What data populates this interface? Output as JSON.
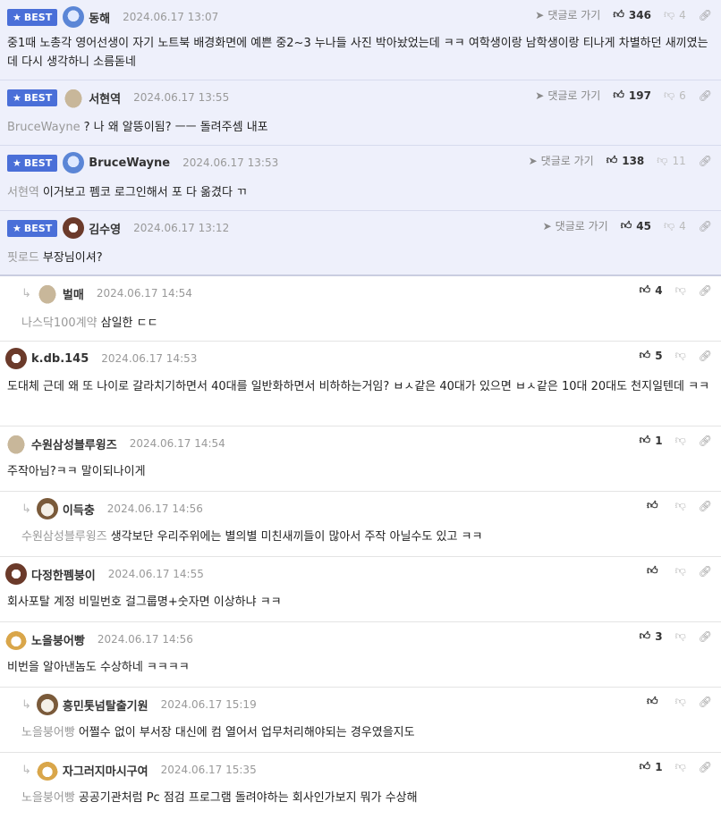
{
  "comments": [
    {
      "best": true,
      "badge": "BEST",
      "avatar": "av-blue",
      "nick": "동해",
      "date": "2024.06.17 13:07",
      "reply_label": "댓글로 가기",
      "up": "346",
      "down": "4",
      "text": "중1때 노총각 영어선생이 자기 노트북 배경화면에 예쁜 중2~3 누나들 사진 박아놨었는데 ㅋㅋ 여학생이랑 남학생이랑 티나게 차별하던 새끼였는데 다시 생각하니 소름돋네",
      "mention": ""
    },
    {
      "best": true,
      "badge": "BEST",
      "avatar": "av-tan",
      "nick": "서현역",
      "date": "2024.06.17 13:55",
      "reply_label": "댓글로 가기",
      "up": "197",
      "down": "6",
      "mention": "BruceWayne",
      "text": "? 나 왜 알뜽이됨? ㅡㅡ 돌려주셈 내포"
    },
    {
      "best": true,
      "badge": "BEST",
      "avatar": "av-blue",
      "nick": "BruceWayne",
      "date": "2024.06.17 13:53",
      "reply_label": "댓글로 가기",
      "up": "138",
      "down": "11",
      "mention": "서현역",
      "text": "이거보고 펨코 로그인해서 포 다 옮겼다 ㄲ"
    },
    {
      "best": true,
      "badge": "BEST",
      "avatar": "av-dog",
      "nick": "김수영",
      "date": "2024.06.17 13:12",
      "reply_label": "댓글로 가기",
      "up": "45",
      "down": "4",
      "mention": "핏로드",
      "text": "부장님이셔?"
    },
    {
      "reply": true,
      "avatar": "av-tan",
      "nick": "벌매",
      "date": "2024.06.17 14:54",
      "up": "4",
      "mention": "나스닥100계약",
      "text": "삼일한 ㄷㄷ"
    },
    {
      "avatar": "av-dog",
      "nick": "k.db.145",
      "date": "2024.06.17 14:53",
      "up": "5",
      "mention": "",
      "text": "도대체 근데 왜 또 나이로 갈라치기하면서 40대를 일반화하면서 비하하는거임? ㅂㅅ같은 40대가 있으면 ㅂㅅ같은 10대 20대도 천지일텐데 ㅋㅋ"
    },
    {
      "avatar": "av-tan",
      "nick": "수원삼성블루윙즈",
      "date": "2024.06.17 14:54",
      "up": "1",
      "mention": "",
      "text": "주작아님?ㅋㅋ 말이되나이게"
    },
    {
      "reply": true,
      "avatar": "av-dogw",
      "nick": "이득충",
      "date": "2024.06.17 14:56",
      "up": "",
      "mention": "수원삼성블루윙즈",
      "text": "생각보단 우리주위에는 별의별 미친새끼들이 많아서 주작 아닐수도 있고 ㅋㅋ"
    },
    {
      "avatar": "av-dog",
      "nick": "다정한펨붕이",
      "date": "2024.06.17 14:55",
      "up": "",
      "mention": "",
      "text": "회사포탈 계정 비밀번호 걸그룹명+숫자면 이상하냐 ㅋㅋ"
    },
    {
      "avatar": "av-fox",
      "nick": "노을붕어빵",
      "date": "2024.06.17 14:56",
      "up": "3",
      "mention": "",
      "text": "비번을 알아낸놈도 수상하네 ㅋㅋㅋㅋ"
    },
    {
      "reply": true,
      "avatar": "av-dogw",
      "nick": "흥민톳넘탈출기원",
      "date": "2024.06.17 15:19",
      "up": "",
      "mention": "노을붕어빵",
      "text": "어쩔수 없이 부서장 대신에 컴 열어서 업무처리해야되는 경우였을지도"
    },
    {
      "reply": true,
      "avatar": "av-fox",
      "nick": "자그러지마시구여",
      "date": "2024.06.17 15:35",
      "up": "1",
      "mention": "노을붕어빵",
      "text": "공공기관처럼 Pc 점검 프로그램 돌려야하는 회사인가보지 뭐가 수상해"
    }
  ]
}
